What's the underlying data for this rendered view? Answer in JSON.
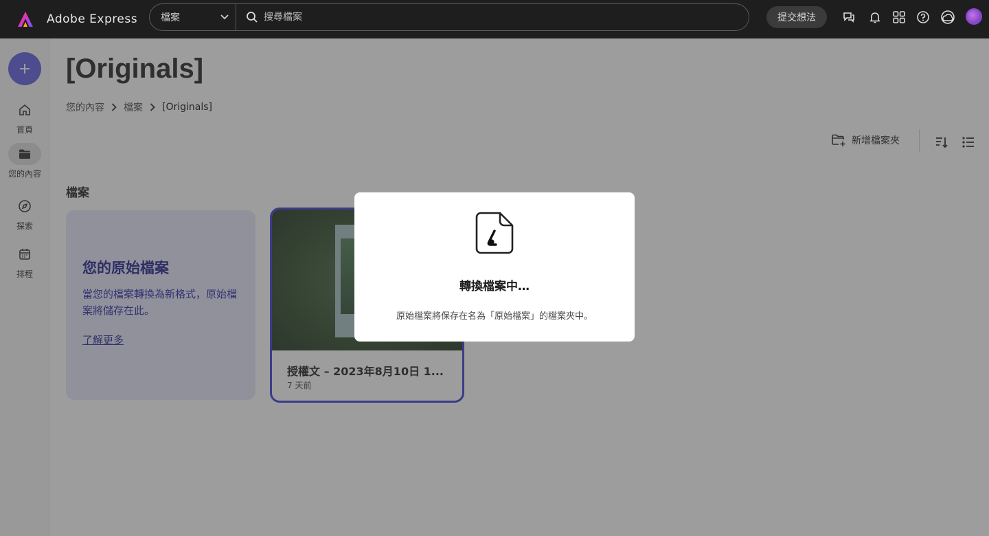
{
  "app": {
    "name": "Adobe Express"
  },
  "header": {
    "scope_label": "檔案",
    "search_placeholder": "搜尋檔案",
    "feedback_label": "提交想法"
  },
  "sidebar": {
    "items": [
      {
        "label": "首頁",
        "icon": "home-icon"
      },
      {
        "label": "您的內容",
        "icon": "folder-icon",
        "active": true
      },
      {
        "label": "探索",
        "icon": "compass-icon"
      },
      {
        "label": "排程",
        "icon": "calendar-icon"
      }
    ]
  },
  "page": {
    "title": "[Originals]",
    "breadcrumb": [
      "您的內容",
      "檔案",
      "[Originals]"
    ],
    "new_folder_label": "新增檔案夾",
    "section_heading": "檔案"
  },
  "info_card": {
    "title": "您的原始檔案",
    "description": "當您的檔案轉換為新格式，原始檔案將儲存在此。",
    "link": "了解更多"
  },
  "file_card": {
    "name": "授權文 – 2023年8月10日 1...",
    "meta": "7 天前"
  },
  "dialog": {
    "title": "轉換檔案中…",
    "description": "原始檔案將保存在名為「原始檔案」的檔案夾中。"
  },
  "colors": {
    "accent": "#5c5ce0",
    "card_border": "#3b3bd6",
    "info_card_bg": "#e6e6fb"
  }
}
